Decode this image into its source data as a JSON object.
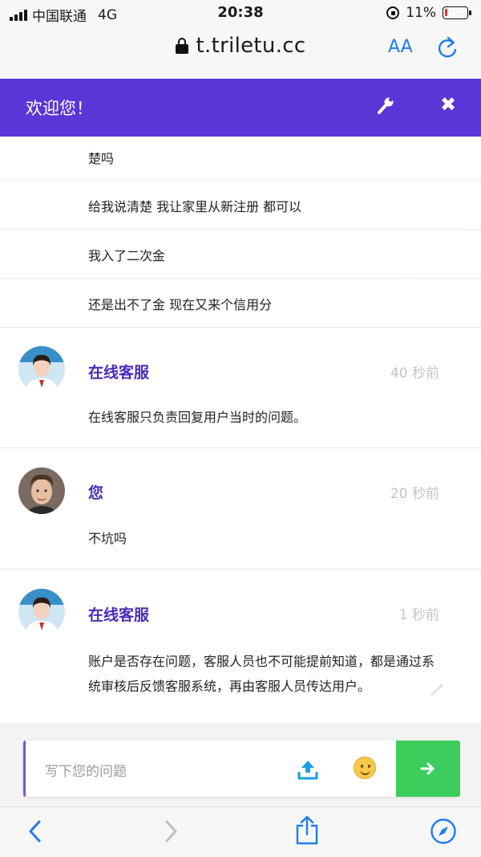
{
  "status_bar": {
    "carrier": "中国联通",
    "network": "4G",
    "time": "20:38",
    "battery_percent": "11%",
    "battery_level": 0.11
  },
  "browser": {
    "url": "t.triletu.cc",
    "text_size_label": "AA"
  },
  "header": {
    "title": "欢迎您！"
  },
  "chat": {
    "continued_lines": [
      "楚吗",
      "给我说清楚 我让家里从新注册 都可以",
      "我入了二次金",
      "还是出不了金 现在又来个信用分"
    ],
    "messages": [
      {
        "sender": "在线客服",
        "time": "40 秒前",
        "text": "在线客服只负责回复用户当时的问题。"
      },
      {
        "sender": "您",
        "time": "20 秒前",
        "text": "不坑吗"
      },
      {
        "sender": "在线客服",
        "time": "1 秒前",
        "text": "账户是否存在问题，客服人员也不可能提前知道，都是通过系统审核后反馈客服系统，再由客服人员传达用户。"
      }
    ]
  },
  "composer": {
    "placeholder": "写下您的问题"
  },
  "colors": {
    "header_bg": "#5b35d5",
    "sender_name": "#4a2ab8",
    "send_button": "#3ccd5c",
    "ios_blue": "#1f7cf2"
  },
  "icons": [
    "wrench-icon",
    "close-icon",
    "upload-icon",
    "smile-emoji-icon",
    "arrow-right-icon",
    "back-icon",
    "forward-icon",
    "share-icon",
    "compass-icon",
    "reload-icon",
    "padlock-icon"
  ]
}
